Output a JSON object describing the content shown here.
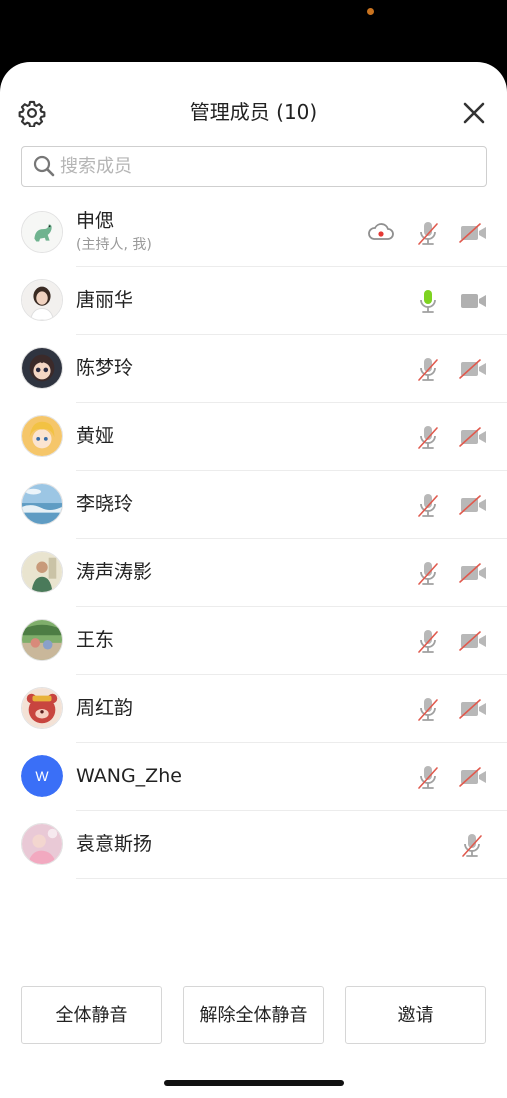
{
  "header": {
    "title": "管理成员 (10)",
    "settings_icon": "gear-icon",
    "close_icon": "close-icon"
  },
  "search": {
    "placeholder": "搜索成员",
    "value": "",
    "icon": "search-icon"
  },
  "members": [
    {
      "name": "申偲",
      "subtitle": "(主持人, 我)",
      "avatar": "dinosaur",
      "recording": true,
      "mic": "muted",
      "camera": "off"
    },
    {
      "name": "唐丽华",
      "avatar": "portrait",
      "mic": "active",
      "camera": "on"
    },
    {
      "name": "陈梦玲",
      "avatar": "cartoon-girl",
      "mic": "muted",
      "camera": "off"
    },
    {
      "name": "黄娅",
      "avatar": "anime-blonde",
      "mic": "muted",
      "camera": "off"
    },
    {
      "name": "李晓玲",
      "avatar": "seascape",
      "mic": "muted",
      "camera": "off"
    },
    {
      "name": "涛声涛影",
      "avatar": "man-portrait",
      "mic": "muted",
      "camera": "off"
    },
    {
      "name": "王东",
      "avatar": "outdoor",
      "mic": "muted",
      "camera": "off"
    },
    {
      "name": "周红韵",
      "avatar": "strawberry-bear",
      "mic": "muted",
      "camera": "off"
    },
    {
      "name": "WANG_Zhe",
      "avatar_initial": "W",
      "avatar": "initial",
      "mic": "muted",
      "camera": "off"
    },
    {
      "name": "袁意斯扬",
      "avatar": "pink-photo",
      "mic": "muted"
    }
  ],
  "footer": {
    "mute_all": "全体静音",
    "unmute_all": "解除全体静音",
    "invite": "邀请"
  },
  "colors": {
    "accent_blue": "#3a6ff7",
    "mic_active": "#7ed321",
    "muted_slash": "#e05a4e",
    "recording": "#e53935",
    "icon_gray": "#9a9a9a"
  }
}
